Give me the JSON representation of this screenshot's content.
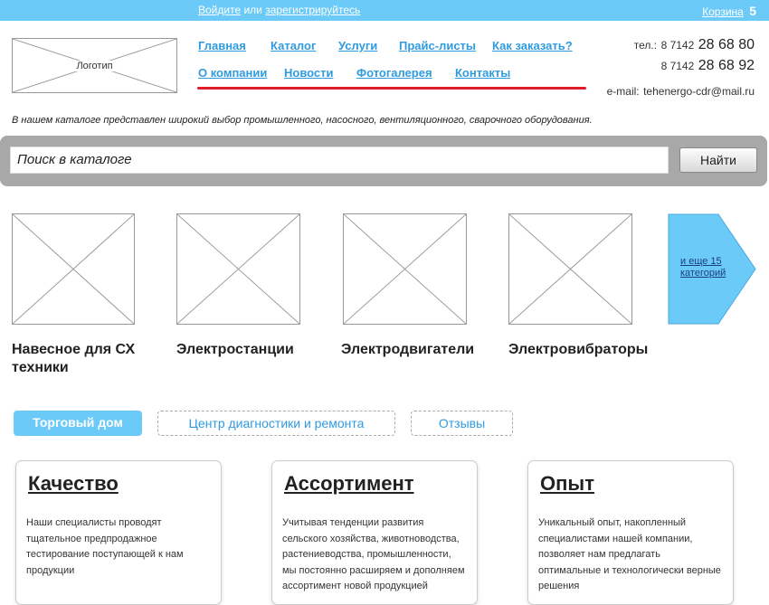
{
  "topbar": {
    "login": "Войдите",
    "or": "или",
    "register": "зарегистрируйтесь",
    "cart_label": "Корзина",
    "cart_count": "5"
  },
  "logo": {
    "label": "Логотип"
  },
  "nav": {
    "row1": [
      "Главная",
      "Каталог",
      "Услуги",
      "Прайс-листы",
      "Как заказать?"
    ],
    "row2": [
      "О компании",
      "Новости",
      "Фотогалерея",
      "Контакты"
    ]
  },
  "contacts": {
    "phone_label": "тел.:",
    "phone1_code": "8 7142",
    "phone1_number": "28 68 80",
    "phone2_code": "8 7142",
    "phone2_number": "28 68 92",
    "email_label": "e-mail:",
    "email": "tehenergo-cdr@mail.ru"
  },
  "intro": "В нашем каталоге представлен широкий выбор промышленного, насосного, вентиляционного, сварочного оборудования.",
  "search": {
    "placeholder": "Поиск в каталоге",
    "button": "Найти"
  },
  "categories": [
    {
      "title": "Навесное для СХ техники"
    },
    {
      "title": "Электростанции"
    },
    {
      "title": "Электродвигатели"
    },
    {
      "title": "Электровибраторы"
    }
  ],
  "more_categories": "и еще 15 категорий",
  "tabs": [
    {
      "label": "Торговый дом",
      "active": true
    },
    {
      "label": "Центр диагностики и ремонта",
      "active": false
    },
    {
      "label": "Отзывы",
      "active": false
    }
  ],
  "cards": [
    {
      "title": "Качество",
      "text": "Наши специалисты проводят тщательное предпродажное тестирование поступающей к нам продукции"
    },
    {
      "title": "Ассортимент",
      "text": "Учитывая тенденции развития сельского хозяйства, животноводства, растениеводства, промышленности, мы постоянно расширяем и дополняем ассортимент новой продукцией"
    },
    {
      "title": "Опыт",
      "text": "Уникальный опыт, накопленный специалистами нашей компании, позволяет нам предлагать оптимальные и технологически верные решения"
    }
  ],
  "colors": {
    "accent": "#6ccaf8",
    "link": "#2f9be0",
    "nav_underline": "#e01e2a",
    "search_bar": "#a8a8a8"
  }
}
